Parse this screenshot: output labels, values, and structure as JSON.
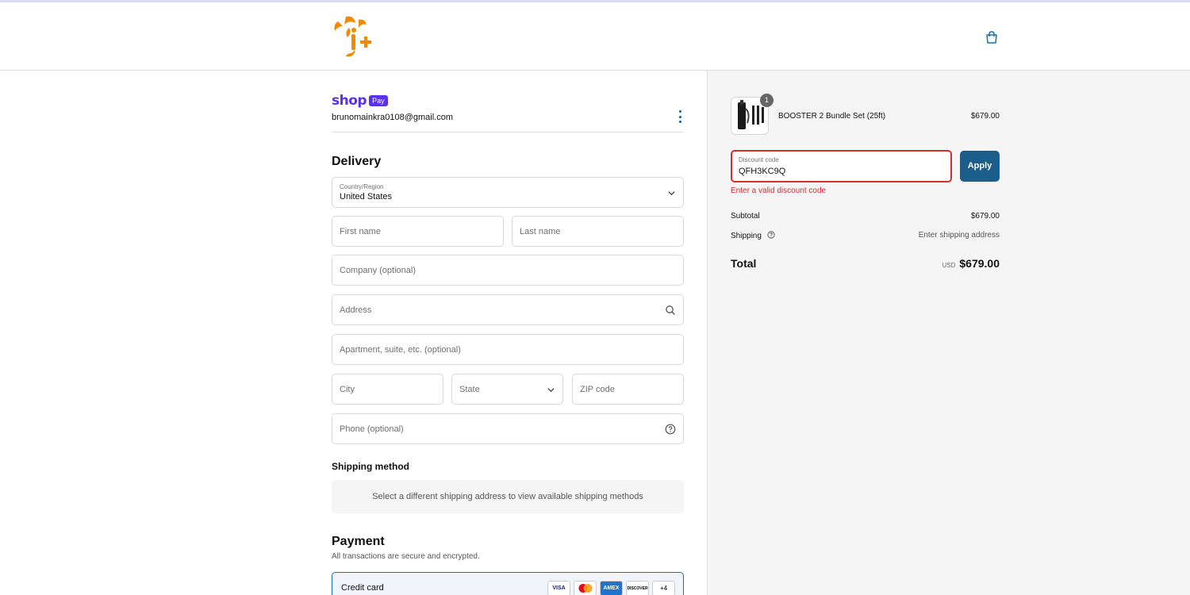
{
  "shop_pay": {
    "word": "shop",
    "badge": "Pay",
    "email": "brunomainkra0108@gmail.com"
  },
  "delivery": {
    "heading": "Delivery",
    "country_label": "Country/Region",
    "country_value": "United States",
    "first_name": "First name",
    "last_name": "Last name",
    "company": "Company (optional)",
    "address": "Address",
    "apartment": "Apartment, suite, etc. (optional)",
    "city": "City",
    "state": "State",
    "zip": "ZIP code",
    "phone": "Phone (optional)"
  },
  "shipping_method": {
    "heading": "Shipping method",
    "hint": "Select a different shipping address to view available shipping methods"
  },
  "payment": {
    "heading": "Payment",
    "subtext": "All transactions are secure and encrypted.",
    "option_label": "Credit card",
    "cards": [
      "VISA",
      "",
      "AMEX",
      "DISCOVER",
      "+4"
    ]
  },
  "summary": {
    "item": {
      "quantity": "1",
      "name": "BOOSTER 2 Bundle Set (25ft)",
      "price": "$679.00"
    },
    "discount": {
      "label": "Discount code",
      "value": "QFH3KC9Q",
      "apply": "Apply",
      "error": "Enter a valid discount code"
    },
    "subtotal_label": "Subtotal",
    "subtotal_value": "$679.00",
    "shipping_label": "Shipping",
    "shipping_value": "Enter shipping address",
    "total_label": "Total",
    "currency": "USD",
    "total_value": "$679.00"
  },
  "colors": {
    "accent": "#1b5e8b",
    "shop_pay": "#5a31f4",
    "error": "#d92c2c",
    "logo": "#f08a00"
  },
  "icons": [
    "brand-logo",
    "shopping-bag-icon",
    "kebab-menu-icon",
    "chevron-down-icon",
    "search-icon",
    "help-circle-icon"
  ]
}
